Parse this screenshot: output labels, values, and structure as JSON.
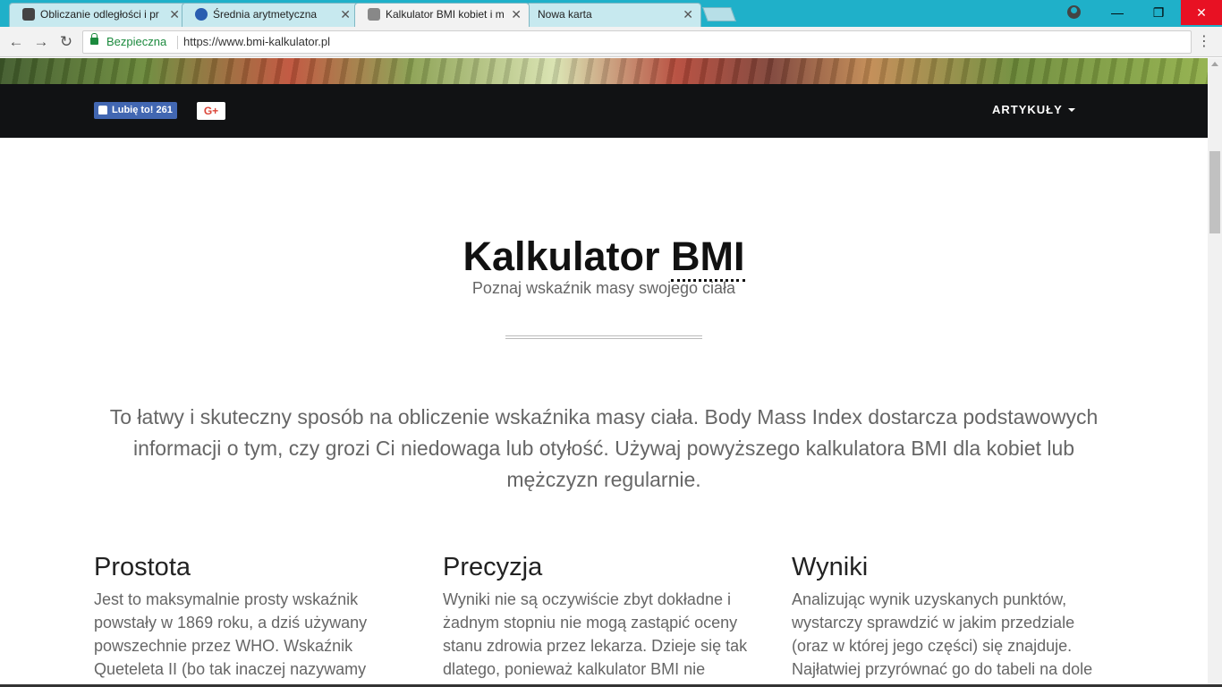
{
  "browser": {
    "tabs": [
      {
        "title": "Obliczanie odległości i pr",
        "fav_color": "#444444"
      },
      {
        "title": "Średnia arytmetyczna",
        "fav_color": "#2a5db0"
      },
      {
        "title": "Kalkulator BMI kobiet i m",
        "fav_color": "#888888"
      },
      {
        "title": "Nowa karta",
        "fav_color": ""
      }
    ],
    "security_label": "Bezpieczna",
    "url": "https://www.bmi-kalkulator.pl",
    "accent": "#1fb0c9"
  },
  "navbar": {
    "fb_like_label": "Lubię to! 261",
    "gplus_label": "G+",
    "articles_label": "ARTYKUŁY"
  },
  "header": {
    "title_main": "Kalkulator ",
    "title_abbr": "BMI",
    "subtitle": "Poznaj wskaźnik masy swojego ciała"
  },
  "intro": "To łatwy i skuteczny sposób na obliczenie wskaźnika masy ciała. Body Mass Index dostarcza podstawowych informacji o tym, czy grozi Ci niedowaga lub otyłość. Używaj powyższego kalkulatora BMI dla kobiet lub mężczyzn regularnie.",
  "features": [
    {
      "heading": "Prostota",
      "text": "Jest to maksymalnie prosty wskaźnik powstały w 1869 roku, a dziś używany powszechnie przez WHO. Wskaźnik Queteleta II (bo tak inaczej nazywamy"
    },
    {
      "heading": "Precyzja",
      "text": "Wyniki nie są oczywiście zbyt dokładne i żadnym stopniu nie mogą zastąpić oceny stanu zdrowia przez lekarza. Dzieje się tak dlatego, ponieważ kalkulator BMI nie"
    },
    {
      "heading": "Wyniki",
      "text": "Analizując wynik uzyskanych punktów, wystarczy sprawdzić w jakim przedziale (oraz w której jego części) się znajduje. Najłatwiej przyrównać go do tabeli na dole"
    }
  ]
}
